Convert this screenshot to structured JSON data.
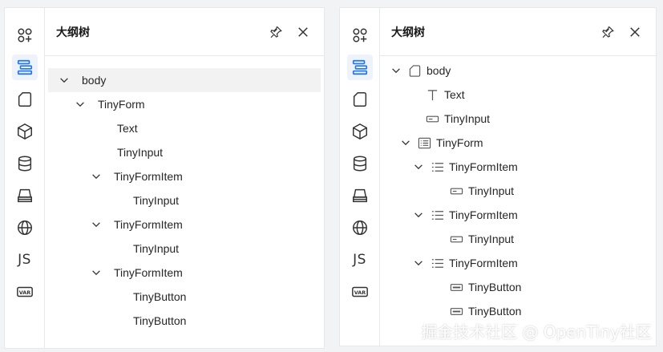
{
  "left_panel": {
    "title": "大纲树",
    "tree": [
      {
        "label": "body",
        "expanded": true,
        "selected": true
      },
      {
        "label": "TinyForm",
        "expanded": true
      },
      {
        "label": "Text"
      },
      {
        "label": "TinyInput"
      },
      {
        "label": "TinyFormItem",
        "expanded": true
      },
      {
        "label": "TinyInput"
      },
      {
        "label": "TinyFormItem",
        "expanded": true
      },
      {
        "label": "TinyInput"
      },
      {
        "label": "TinyFormItem",
        "expanded": true
      },
      {
        "label": "TinyButton"
      },
      {
        "label": "TinyButton"
      }
    ]
  },
  "right_panel": {
    "title": "大纲树",
    "tree": [
      {
        "label": "body",
        "icon": "page-icon",
        "expanded": true
      },
      {
        "label": "Text",
        "icon": "text-icon"
      },
      {
        "label": "TinyInput",
        "icon": "input-icon"
      },
      {
        "label": "TinyForm",
        "icon": "form-icon",
        "expanded": true
      },
      {
        "label": "TinyFormItem",
        "icon": "list-icon",
        "expanded": true
      },
      {
        "label": "TinyInput",
        "icon": "input-icon"
      },
      {
        "label": "TinyFormItem",
        "icon": "list-icon",
        "expanded": true
      },
      {
        "label": "TinyInput",
        "icon": "input-icon"
      },
      {
        "label": "TinyFormItem",
        "icon": "list-icon",
        "expanded": true
      },
      {
        "label": "TinyButton",
        "icon": "button-icon"
      },
      {
        "label": "TinyButton",
        "icon": "button-icon"
      }
    ]
  },
  "rail": {
    "js_label": "JS",
    "var_label": "VAR",
    "icons": [
      "components-icon",
      "outline-icon",
      "page-icon",
      "block-icon",
      "datasource-icon",
      "bridge-icon",
      "i18n-icon",
      "js-icon",
      "variables-icon"
    ],
    "active": "outline-icon",
    "accent": "#1f74ff"
  },
  "watermark": "掘金技术社区 @ OpenTiny社区"
}
